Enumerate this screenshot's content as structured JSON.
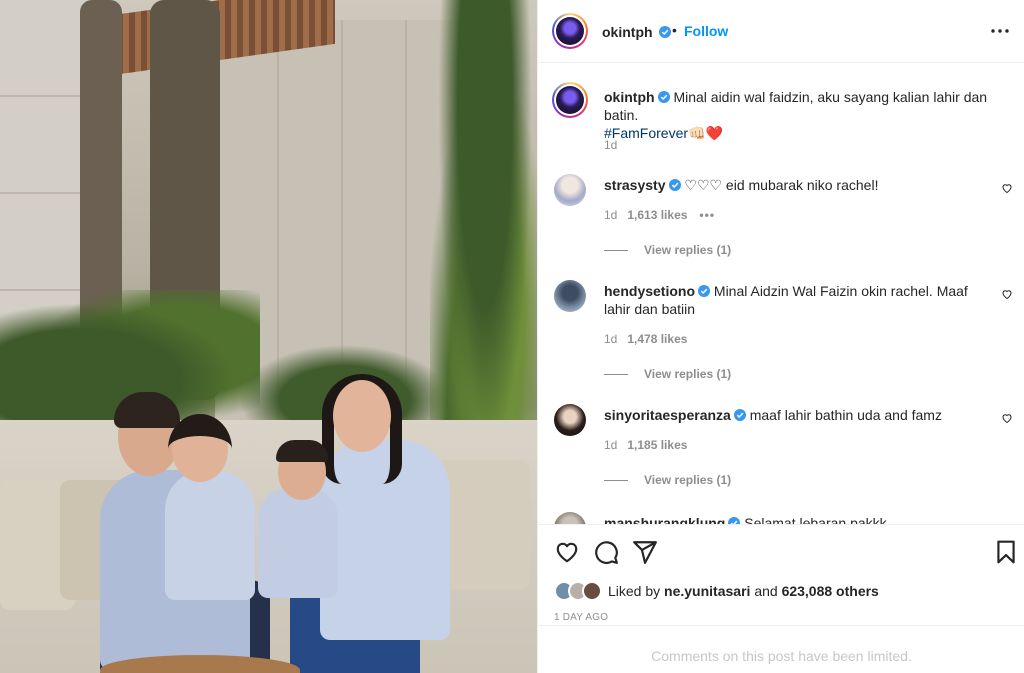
{
  "post": {
    "author": "okintph",
    "follow_label": "Follow",
    "dot": "•",
    "caption_text": "Minal aidin wal faidzin, aku sayang kalian lahir dan batin.",
    "caption_hashtag": "#FamForever",
    "caption_emoji": "👊🏻❤️",
    "caption_time": "1d"
  },
  "comments": [
    {
      "username": "strasysty",
      "text": "♡♡♡ eid mubarak niko rachel!",
      "time": "1d",
      "likes": "1,613 likes",
      "more": "•••",
      "replies": "View replies (1)"
    },
    {
      "username": "hendysetiono",
      "text": "Minal Aidzin Wal Faizin okin rachel. Maaf lahir dan batiin",
      "time": "1d",
      "likes": "1,478 likes",
      "replies": "View replies (1)"
    },
    {
      "username": "sinyoritaesperanza",
      "text": "maaf lahir bathin uda and famz",
      "time": "1d",
      "likes": "1,185 likes",
      "replies": "View replies (1)"
    },
    {
      "username": "manshurangklung",
      "text": "Selamat lebaran pakkk"
    }
  ],
  "engagement": {
    "liked_by_prefix": "Liked by",
    "liked_by_user": "ne.yunitasari",
    "liked_by_and": "and",
    "liked_by_others": "623,088 others",
    "posted_ago": "1 DAY AGO",
    "comments_limited": "Comments on this post have been limited."
  },
  "icons": {
    "header_more": "more-horizontal-icon",
    "verified": "verified-badge-icon",
    "like": "heart-icon",
    "comment": "comment-bubble-icon",
    "share": "paper-plane-icon",
    "save": "bookmark-icon"
  },
  "colors": {
    "link_blue": "#0095f6",
    "hashtag": "#00376b",
    "muted": "#8e8e8e",
    "verified": "#3897f0"
  }
}
